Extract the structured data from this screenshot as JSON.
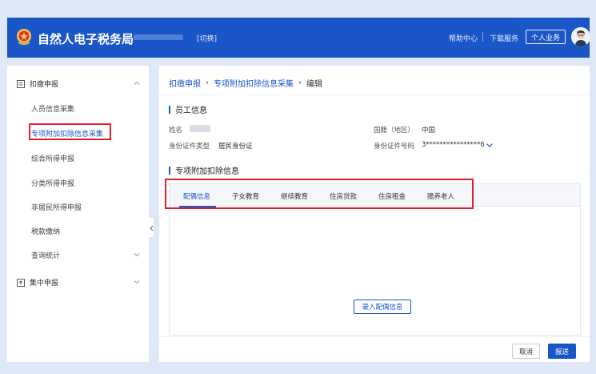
{
  "header": {
    "app_title": "自然人电子税务局",
    "org_prefix": "迪",
    "switch_label": "[切换]",
    "help_label": "帮助中心",
    "download_label": "下载服务",
    "personal_business_label": "个人业务",
    "brand_color": "#1a56c8"
  },
  "sidebar": {
    "groups": [
      {
        "label": "扣缴申报",
        "icon": "document-icon"
      },
      {
        "label": "集中申报",
        "icon": "upload-icon"
      }
    ],
    "items": [
      {
        "label": "人员信息采集"
      },
      {
        "label": "专项附加扣除信息采集",
        "active": true
      },
      {
        "label": "综合所得申报"
      },
      {
        "label": "分类所得申报"
      },
      {
        "label": "非居民所得申报"
      },
      {
        "label": "税款缴纳"
      },
      {
        "label": "查询统计"
      }
    ]
  },
  "breadcrumb": [
    {
      "label": "扣缴申报"
    },
    {
      "label": "专项附加扣除信息采集"
    },
    {
      "label": "编辑"
    }
  ],
  "employee_info": {
    "section_title": "员工信息",
    "name_label": "姓名",
    "id_type_label": "身份证件类型",
    "id_type_value": "居民身份证",
    "nationality_label": "国籍（地区）",
    "nationality_value": "中国",
    "id_number_label": "身份证件号码",
    "id_number_value": "3****************6"
  },
  "deduction": {
    "section_title": "专项附加扣除信息",
    "tabs": [
      {
        "label": "配偶信息",
        "active": true
      },
      {
        "label": "子女教育"
      },
      {
        "label": "继续教育"
      },
      {
        "label": "住房贷款"
      },
      {
        "label": "住房租金"
      },
      {
        "label": "赡养老人"
      }
    ],
    "enter_button_label": "录入配偶信息"
  },
  "footer": {
    "cancel_label": "取消",
    "submit_label": "报送"
  },
  "highlight_color": "#e0202a"
}
